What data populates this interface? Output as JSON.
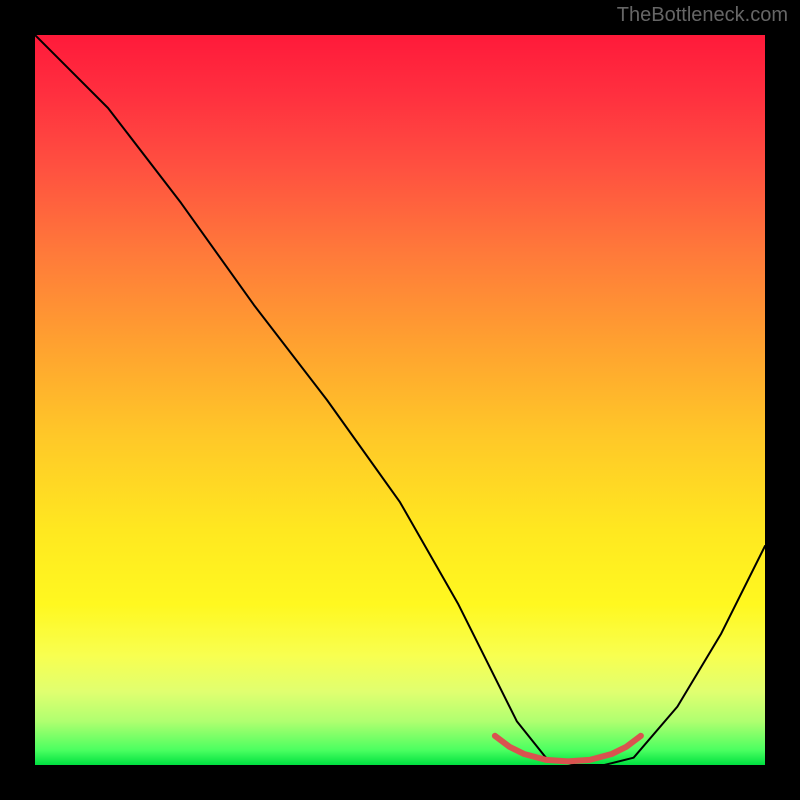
{
  "watermark": "TheBottleneck.com",
  "chart_data": {
    "type": "line",
    "title": "",
    "xlabel": "",
    "ylabel": "",
    "xlim": [
      0,
      100
    ],
    "ylim": [
      0,
      100
    ],
    "series": [
      {
        "name": "bottleneck-curve",
        "x": [
          0,
          4,
          10,
          20,
          30,
          40,
          50,
          58,
          62,
          66,
          70,
          74,
          78,
          82,
          88,
          94,
          100
        ],
        "y": [
          100,
          96,
          90,
          77,
          63,
          50,
          36,
          22,
          14,
          6,
          1,
          0,
          0,
          1,
          8,
          18,
          30
        ],
        "color": "#000000"
      },
      {
        "name": "optimal-zone",
        "x": [
          63,
          65,
          67,
          70,
          73,
          76,
          79,
          81,
          83
        ],
        "y": [
          4,
          2.5,
          1.5,
          0.7,
          0.5,
          0.7,
          1.5,
          2.5,
          4
        ],
        "color": "#d9534f"
      }
    ],
    "gradient": {
      "top_color": "#ff1a3a",
      "mid_color": "#ffea20",
      "bottom_color": "#00e040"
    },
    "annotations": []
  }
}
